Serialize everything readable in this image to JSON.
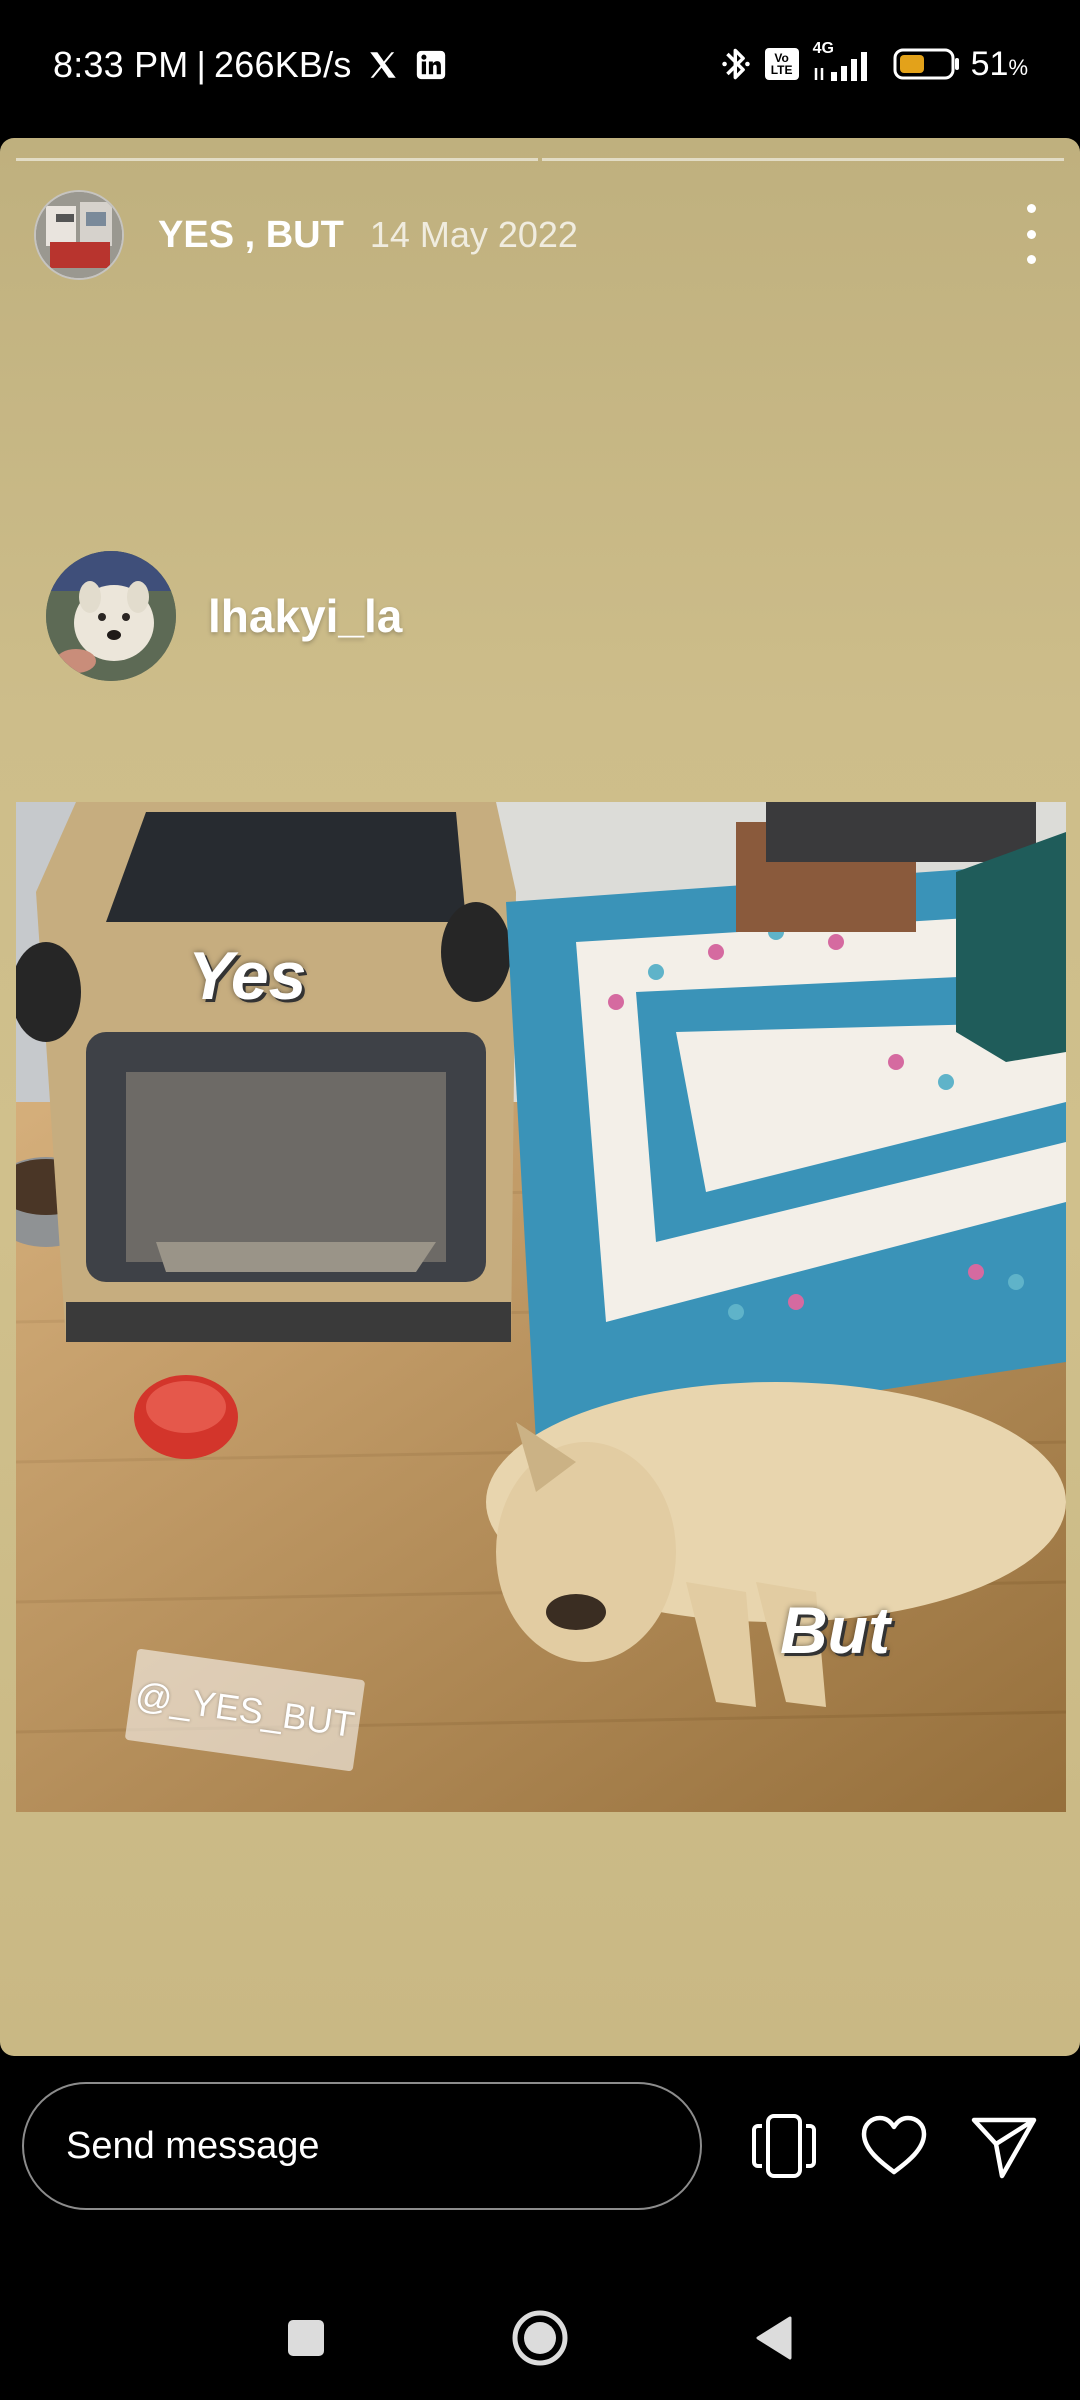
{
  "status_bar": {
    "time": "8:33 PM",
    "separator": "|",
    "speed": "266KB/s",
    "network_badge": "Vo LTE",
    "network_type": "4G",
    "battery_percent": "51",
    "battery_unit": "%",
    "battery_level": 0.51,
    "icons": [
      "x-logo-icon",
      "linkedin-icon",
      "bluetooth-icon",
      "volte-icon",
      "signal-icon",
      "battery-icon"
    ]
  },
  "story": {
    "progress_segments": 2,
    "progress_current": 0,
    "username": "YES , BUT",
    "date": "14 May 2022",
    "tagged_user": "lhakyi_la",
    "overlay_yes": "Yes",
    "overlay_but": "But",
    "watermark": "@_YES_BUT"
  },
  "reply": {
    "placeholder": "Send message"
  },
  "colors": {
    "story_bg": "#cdbd8a",
    "battery_fill": "#e3a21a"
  }
}
